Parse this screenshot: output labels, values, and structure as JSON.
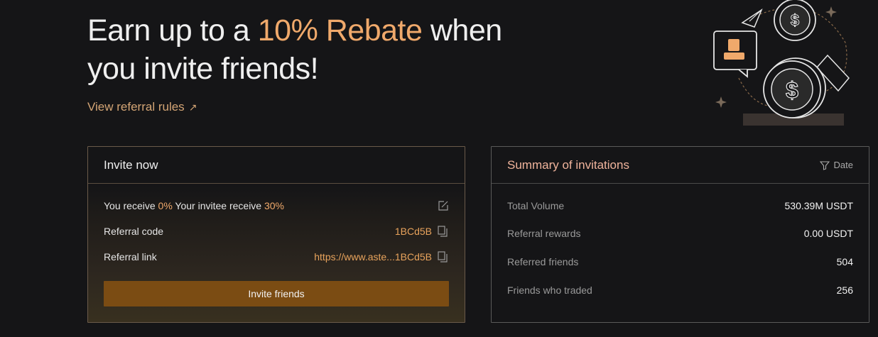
{
  "header": {
    "title_prefix": "Earn up to a ",
    "title_accent": "10% Rebate",
    "title_suffix": " when you invite friends!",
    "rules_link": "View referral rules"
  },
  "invite": {
    "title": "Invite now",
    "you_receive_label": "You receive",
    "you_receive_value": "0%",
    "invitee_label": "Your invitee receive",
    "invitee_value": "30%",
    "code_label": "Referral code",
    "code_value": "1BCd5B",
    "link_label": "Referral link",
    "link_value": "https://www.aste...1BCd5B",
    "button_label": "Invite friends"
  },
  "summary": {
    "title": "Summary of invitations",
    "date_filter": "Date",
    "rows": [
      {
        "label": "Total Volume",
        "value": "530.39M USDT"
      },
      {
        "label": "Referral rewards",
        "value": "0.00 USDT"
      },
      {
        "label": "Referred friends",
        "value": "504"
      },
      {
        "label": "Friends who traded",
        "value": "256"
      }
    ]
  },
  "colors": {
    "accent": "#f0a96b",
    "button": "#7b4c13",
    "summary_title": "#f0b49c"
  },
  "icons": [
    "external-arrow-icon",
    "edit-icon",
    "copy-icon",
    "filter-icon",
    "dollar-coin-icon",
    "user-chat-icon",
    "paper-plane-icon",
    "sparkle-icon"
  ]
}
